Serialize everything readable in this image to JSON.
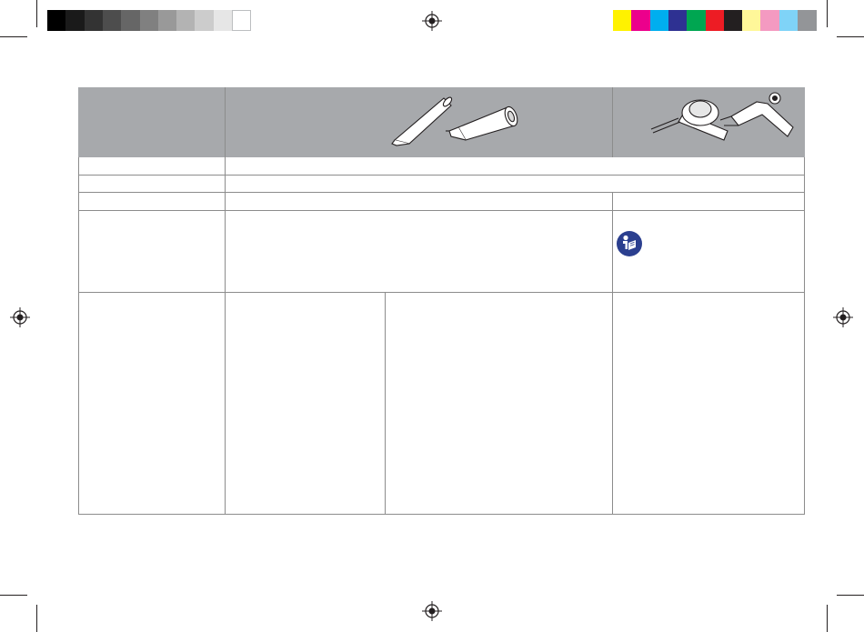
{
  "print_marks": {
    "gray_bar": [
      "#000000",
      "#1a1a1a",
      "#333333",
      "#4d4d4d",
      "#666666",
      "#808080",
      "#999999",
      "#b3b3b3",
      "#cccccc",
      "#e6e6e6",
      "#ffffff"
    ],
    "color_bar": [
      "#fff200",
      "#ec008c",
      "#00aeef",
      "#2e3192",
      "#00a651",
      "#ed1c24",
      "#231f20",
      "#fff799",
      "#f49ac1",
      "#7fd3f7",
      "#939598"
    ],
    "registration_mark_icon": "registration-target-icon"
  },
  "table": {
    "header_color": "#a7a9ac",
    "border_color": "#8c8c8c",
    "header_images": [
      "nozzle-tips-illustration",
      "handpiece-illustration"
    ],
    "manual_icon": {
      "name": "read-instructions-icon",
      "color": "#2b3f8f"
    }
  }
}
